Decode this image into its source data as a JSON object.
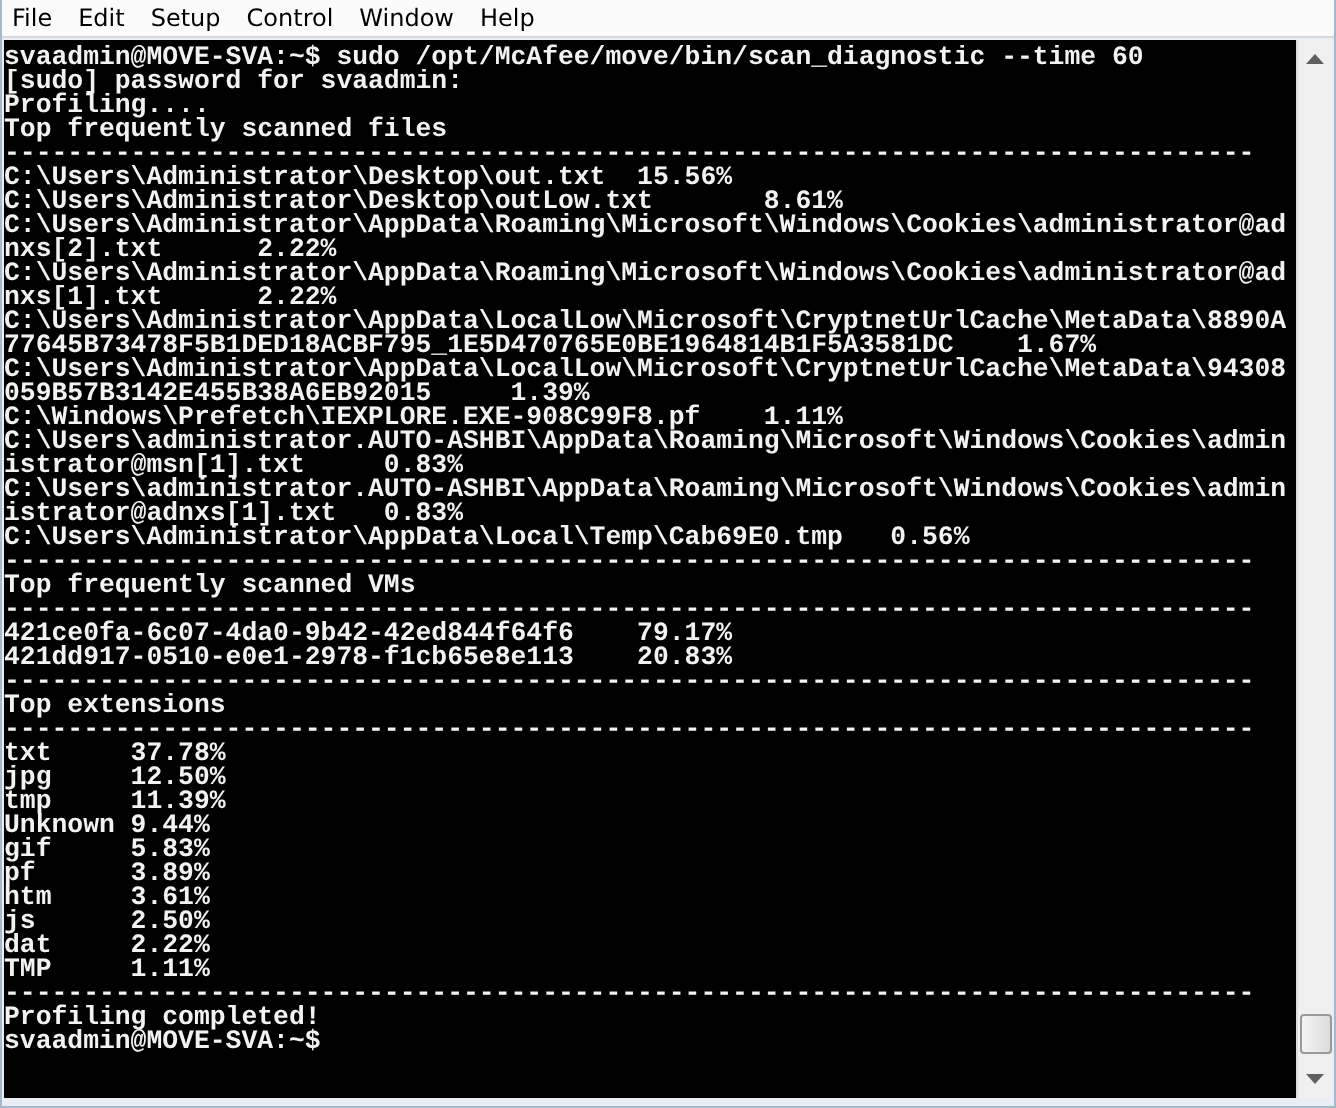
{
  "menu": [
    {
      "label": "File"
    },
    {
      "label": "Edit"
    },
    {
      "label": "Setup"
    },
    {
      "label": "Control"
    },
    {
      "label": "Window"
    },
    {
      "label": "Help"
    }
  ],
  "terminal": {
    "lines": [
      "svaadmin@MOVE-SVA:~$ sudo /opt/McAfee/move/bin/scan_diagnostic --time 60",
      "[sudo] password for svaadmin:",
      "Profiling....",
      "Top frequently scanned files",
      "-------------------------------------------------------------------------------",
      "C:\\Users\\Administrator\\Desktop\\out.txt  15.56%",
      "C:\\Users\\Administrator\\Desktop\\outLow.txt       8.61%",
      "C:\\Users\\Administrator\\AppData\\Roaming\\Microsoft\\Windows\\Cookies\\administrator@ad",
      "nxs[2].txt      2.22%",
      "C:\\Users\\Administrator\\AppData\\Roaming\\Microsoft\\Windows\\Cookies\\administrator@ad",
      "nxs[1].txt      2.22%",
      "C:\\Users\\Administrator\\AppData\\LocalLow\\Microsoft\\CryptnetUrlCache\\MetaData\\8890A",
      "77645B73478F5B1DED18ACBF795_1E5D470765E0BE1964814B1F5A3581DC    1.67%",
      "C:\\Users\\Administrator\\AppData\\LocalLow\\Microsoft\\CryptnetUrlCache\\MetaData\\94308",
      "059B57B3142E455B38A6EB92015     1.39%",
      "C:\\Windows\\Prefetch\\IEXPLORE.EXE-908C99F8.pf    1.11%",
      "C:\\Users\\administrator.AUTO-ASHBI\\AppData\\Roaming\\Microsoft\\Windows\\Cookies\\admin",
      "istrator@msn[1].txt     0.83%",
      "C:\\Users\\administrator.AUTO-ASHBI\\AppData\\Roaming\\Microsoft\\Windows\\Cookies\\admin",
      "istrator@adnxs[1].txt   0.83%",
      "C:\\Users\\Administrator\\AppData\\Local\\Temp\\Cab69E0.tmp   0.56%",
      "-------------------------------------------------------------------------------",
      "Top frequently scanned VMs",
      "-------------------------------------------------------------------------------",
      "421ce0fa-6c07-4da0-9b42-42ed844f64f6    79.17%",
      "421dd917-0510-e0e1-2978-f1cb65e8e113    20.83%",
      "-------------------------------------------------------------------------------",
      "Top extensions",
      "-------------------------------------------------------------------------------",
      "txt     37.78%",
      "jpg     12.50%",
      "tmp     11.39%",
      "Unknown 9.44%",
      "gif     5.83%",
      "pf      3.89%",
      "htm     3.61%",
      "js      2.50%",
      "dat     2.22%",
      "TMP     1.11%",
      "-------------------------------------------------------------------------------",
      "Profiling completed!",
      "svaadmin@MOVE-SVA:~$"
    ]
  }
}
